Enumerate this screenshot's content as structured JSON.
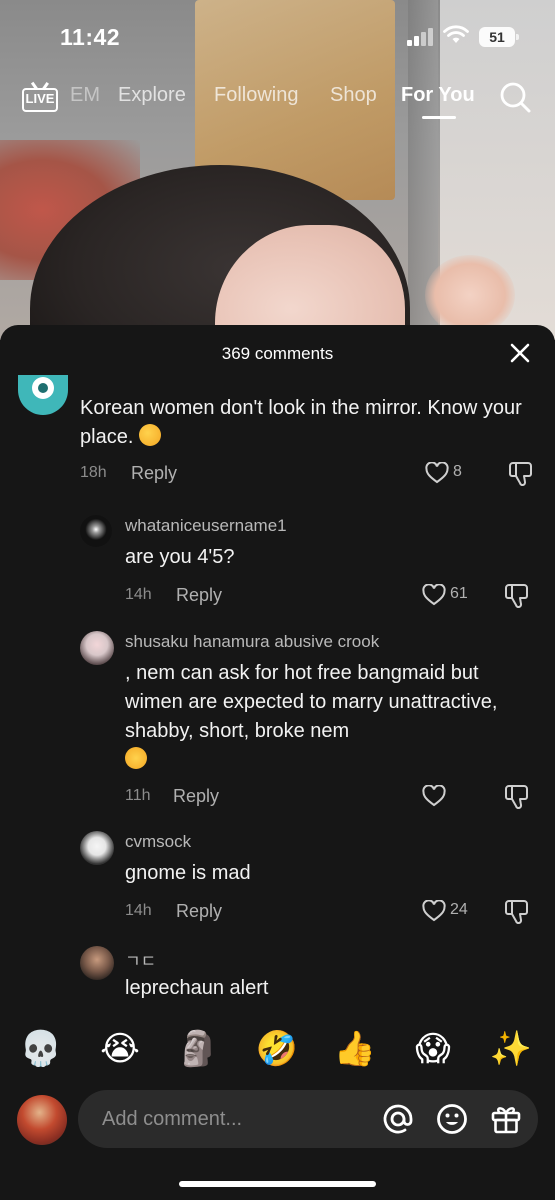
{
  "status_bar": {
    "time": "11:42",
    "battery": "51"
  },
  "top_nav": {
    "live_label": "LIVE",
    "tabs": [
      {
        "label": "EM"
      },
      {
        "label": "Explore"
      },
      {
        "label": "Following"
      },
      {
        "label": "Shop"
      },
      {
        "label": "For You"
      }
    ]
  },
  "comments_panel": {
    "count_label": "369 comments",
    "comments": [
      {
        "username": "",
        "text": "Korean women don't look in the mirror. Know your place.",
        "time": "18h",
        "reply": "Reply",
        "likes": "8",
        "avatar_color": "#3fb7b9"
      },
      {
        "username": "whataniceusername1",
        "text": "are you 4'5?",
        "time": "14h",
        "reply": "Reply",
        "likes": "61",
        "avatar_color": "#111111"
      },
      {
        "username": "shusaku hanamura abusive crook",
        "text": ", nem can ask for hot free bangmaid but wimen are expected to marry unattractive, shabby, short, broke nem",
        "time": "11h",
        "reply": "Reply",
        "likes": "",
        "avatar_color": "#d8c7c9"
      },
      {
        "username": "cvmsock",
        "text": "gnome is mad",
        "time": "14h",
        "reply": "Reply",
        "likes": "24",
        "avatar_color": "#e6e6e6"
      },
      {
        "username": "ㄱㄷ",
        "text": "leprechaun alert",
        "avatar_color": "#7a5a4a"
      }
    ]
  },
  "emoji_bar": [
    "💀",
    "😭",
    "🗿",
    "🤣",
    "👍",
    "😱",
    "✨"
  ],
  "composer": {
    "placeholder": "Add comment..."
  },
  "colors": {
    "sheet_bg": "#161616",
    "input_bg": "#2b2b2b",
    "muted_text": "#8c8c8c"
  }
}
